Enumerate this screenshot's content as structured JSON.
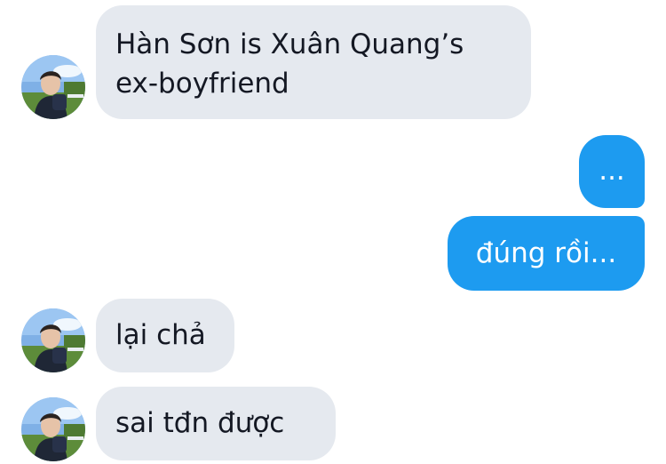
{
  "messages": [
    {
      "sender": "other",
      "text_line1": "Hàn Sơn is Xuân Quang’s",
      "text_line2": "ex-boyfriend",
      "has_avatar": true
    },
    {
      "sender": "me",
      "text": "..."
    },
    {
      "sender": "me",
      "text": "đúng rồi..."
    },
    {
      "sender": "other",
      "text": "lại chả",
      "has_avatar": true
    },
    {
      "sender": "other",
      "text": "sai tđn được",
      "has_avatar": true
    }
  ],
  "colors": {
    "incoming_bubble": "#e5e9ef",
    "outgoing_bubble": "#1d9bf0",
    "incoming_text": "#141823",
    "outgoing_text": "#ffffff"
  },
  "icons": {
    "avatar": "contact-avatar-photo"
  }
}
